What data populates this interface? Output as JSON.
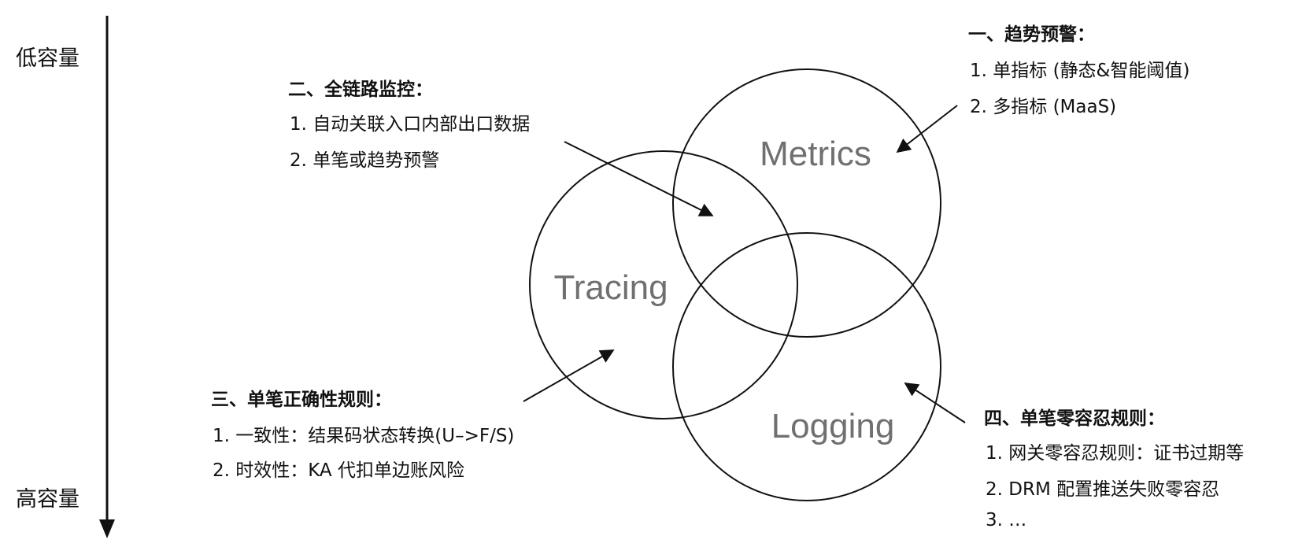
{
  "axis": {
    "top_label": "低容量",
    "bottom_label": "高容量"
  },
  "venn": {
    "metrics": "Metrics",
    "tracing": "Tracing",
    "logging": "Logging"
  },
  "sections": {
    "trend_alert": {
      "title": "一、趋势预警：",
      "items": [
        "1. 单指标 (静态&智能阈值)",
        "2. 多指标 (MaaS)"
      ]
    },
    "full_link": {
      "title": "二、全链路监控：",
      "items": [
        "1. 自动关联入口内部出口数据",
        "2. 单笔或趋势预警"
      ]
    },
    "single_correctness": {
      "title": "三、单笔正确性规则：",
      "items": [
        "1. 一致性：结果码状态转换(U–>F/S)",
        "2. 时效性：KA 代扣单边账风险"
      ]
    },
    "zero_tolerance": {
      "title": "四、单笔零容忍规则：",
      "items": [
        "1. 网关零容忍规则：证书过期等",
        "2. DRM 配置推送失败零容忍",
        "3. …"
      ]
    }
  },
  "colors": {
    "stroke": "#111111",
    "venn_text": "#707070",
    "text": "#111111"
  }
}
